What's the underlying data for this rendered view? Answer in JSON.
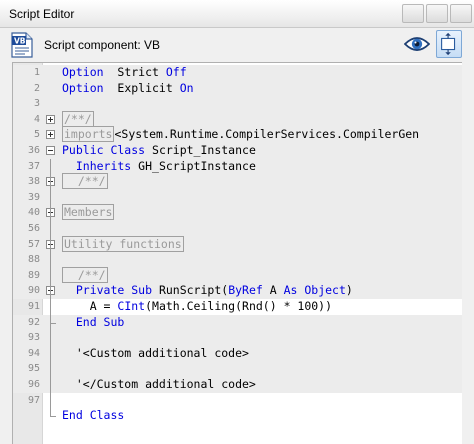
{
  "window": {
    "title": "Script Editor"
  },
  "header": {
    "component_label": "Script component: VB",
    "icon_text": "VB",
    "icons": [
      "vb-script-icon",
      "eye-icon",
      "expand-icon"
    ]
  },
  "colors": {
    "keyword": "#0000e0",
    "gutter": "#e8e8e8",
    "line_highlight": "#ececec"
  },
  "editor": {
    "lines": [
      {
        "num": "1",
        "tokens": [
          [
            "kw",
            "Option"
          ],
          [
            "",
            "  Strict "
          ],
          [
            "kw",
            "Off"
          ]
        ]
      },
      {
        "num": "2",
        "tokens": [
          [
            "kw",
            "Option"
          ],
          [
            "",
            "  Explicit "
          ],
          [
            "kw",
            "On"
          ]
        ]
      },
      {
        "num": "3",
        "tokens": []
      },
      {
        "num": "4",
        "tokens": [
          [
            "fold",
            "/**/"
          ]
        ]
      },
      {
        "num": "5",
        "tokens": [
          [
            "fold",
            "imports"
          ],
          [
            "",
            "<System.Runtime.CompilerServices.CompilerGen"
          ]
        ]
      },
      {
        "num": "36",
        "tokens": [
          [
            "kw",
            "Public Class"
          ],
          [
            "",
            " Script_Instance"
          ]
        ]
      },
      {
        "num": "37",
        "tokens": [
          [
            "kw",
            "  Inherits"
          ],
          [
            "",
            " GH_ScriptInstance"
          ]
        ]
      },
      {
        "num": "38",
        "tokens": [
          [
            "fold",
            "  /**/"
          ]
        ]
      },
      {
        "num": "39",
        "tokens": []
      },
      {
        "num": "40",
        "tokens": [
          [
            "fold",
            "Members"
          ]
        ]
      },
      {
        "num": "56",
        "tokens": []
      },
      {
        "num": "57",
        "tokens": [
          [
            "fold",
            "Utility functions"
          ]
        ]
      },
      {
        "num": "88",
        "tokens": []
      },
      {
        "num": "89",
        "tokens": [
          [
            "fold",
            "  /**/"
          ]
        ]
      },
      {
        "num": "90",
        "tokens": [
          [
            "kw",
            "  Private Sub"
          ],
          [
            "",
            " RunScript("
          ],
          [
            "kw",
            "ByRef"
          ],
          [
            "",
            " A "
          ],
          [
            "kw",
            "As Object"
          ],
          [
            "",
            ")"
          ]
        ]
      },
      {
        "num": "91",
        "tokens": [
          [
            "",
            "    A = "
          ],
          [
            "kw",
            "CInt"
          ],
          [
            "",
            "(Math.Ceiling(Rnd() * 100))"
          ]
        ]
      },
      {
        "num": "92",
        "tokens": [
          [
            "kw",
            "  End Sub"
          ]
        ]
      },
      {
        "num": "93",
        "tokens": []
      },
      {
        "num": "94",
        "tokens": [
          [
            "",
            "  '<Custom additional code>"
          ]
        ]
      },
      {
        "num": "95",
        "tokens": []
      },
      {
        "num": "96",
        "tokens": [
          [
            "",
            "  '</Custom additional code>"
          ]
        ]
      },
      {
        "num": "97",
        "tokens": []
      },
      {
        "num": "",
        "tokens": [
          [
            "kw",
            "End Class"
          ]
        ]
      }
    ]
  }
}
